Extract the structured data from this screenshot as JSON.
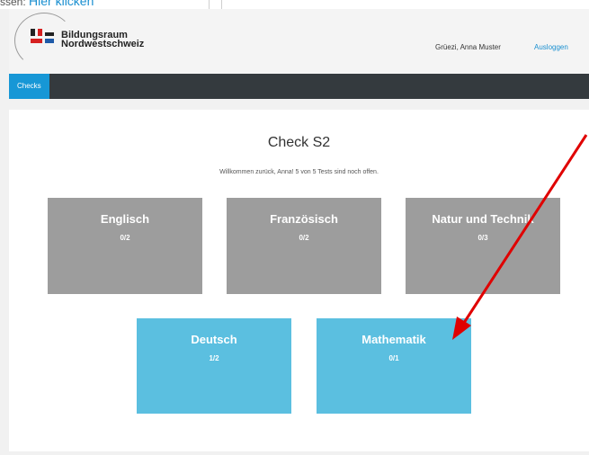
{
  "top_strip": {
    "hint_text": "ssen:",
    "hint_link": "Hier klicken"
  },
  "header": {
    "logo_line1": "Bildungsraum",
    "logo_line2": "Nordwestschweiz",
    "greeting": "Grüezi, Anna Muster",
    "logout": "Ausloggen"
  },
  "nav": {
    "tab_checks": "Checks"
  },
  "main": {
    "title": "Check S2",
    "subtitle": "Willkommen zurück, Anna! 5 von 5 Tests sind noch offen.",
    "tiles": [
      {
        "name": "Englisch",
        "score": "0/2"
      },
      {
        "name": "Französisch",
        "score": "0/2"
      },
      {
        "name": "Natur und Technik",
        "score": "0/3"
      },
      {
        "name": "Deutsch",
        "score": "1/2"
      },
      {
        "name": "Mathematik",
        "score": "0/1"
      }
    ]
  },
  "colors": {
    "tile_grey": "#9d9d9d",
    "tile_blue": "#5bbfe0",
    "nav_dark": "#343a3e",
    "nav_active": "#1797d6",
    "arrow_red": "#e00000"
  }
}
